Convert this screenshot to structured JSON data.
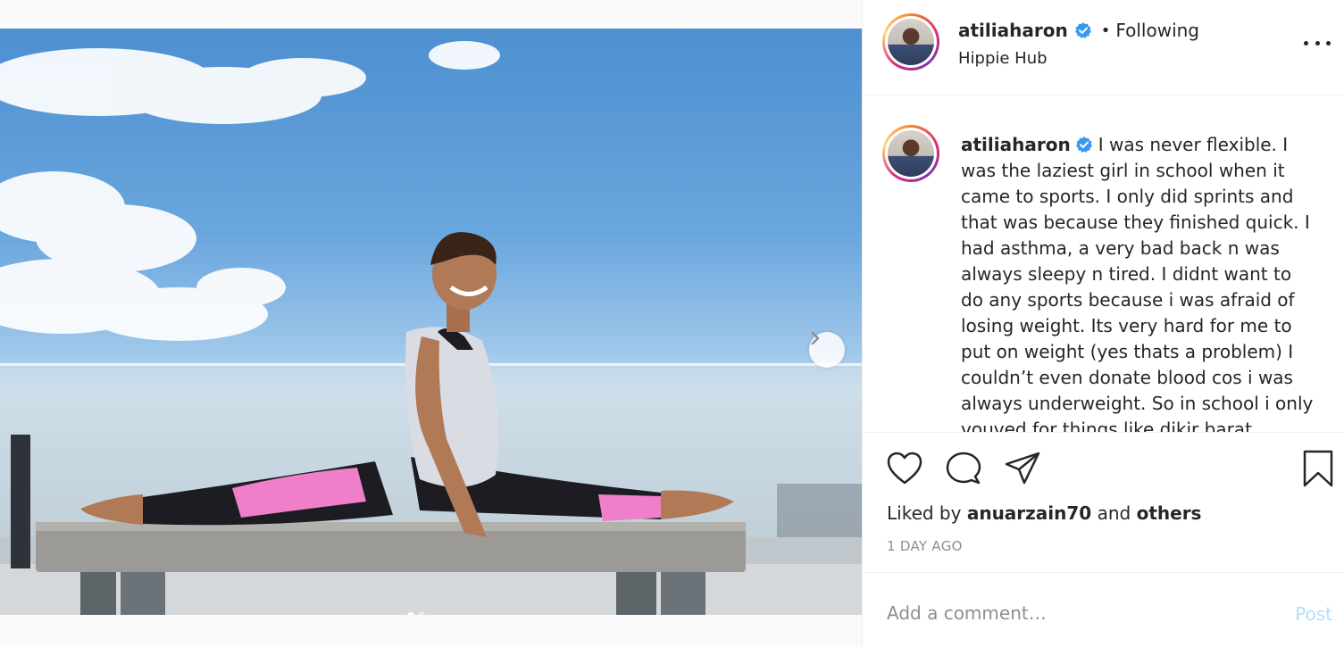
{
  "post": {
    "author": {
      "username": "atiliaharon",
      "verified": true,
      "follow_status": "Following",
      "separator": "•"
    },
    "location": "Hippie Hub",
    "caption_user": "atiliaharon",
    "caption_text": "I was never flexible. I was the laziest girl in school when it came to sports. I only did sprints and that was because they finished quick. I had asthma, a very bad back n was always sleepy n tired. I didnt want to do any sports because i was afraid of losing weight. Its very hard for me to put on weight (yes thats a problem) I couldn’t even donate blood cos i was always underweight. So in school i only vouved for things like dikir barat",
    "likes": {
      "prefix": "Liked by",
      "user": "anuarzain70",
      "joiner": "and",
      "others": "others"
    },
    "timestamp": "1 DAY AGO",
    "comment_placeholder": "Add a comment…",
    "post_label": "Post"
  },
  "carousel": {
    "current_index": 1,
    "total": 2
  },
  "icons": {
    "more": "more-options-icon",
    "like": "heart-icon",
    "comment": "comment-bubble-icon",
    "share": "paper-plane-icon",
    "save": "bookmark-icon",
    "next": "chevron-right-icon",
    "verified": "verified-badge-icon"
  },
  "colors": {
    "verified": "#3897f0",
    "post_disabled": "#b2dffc",
    "meta": "#8e8e8e",
    "text": "#262626"
  }
}
